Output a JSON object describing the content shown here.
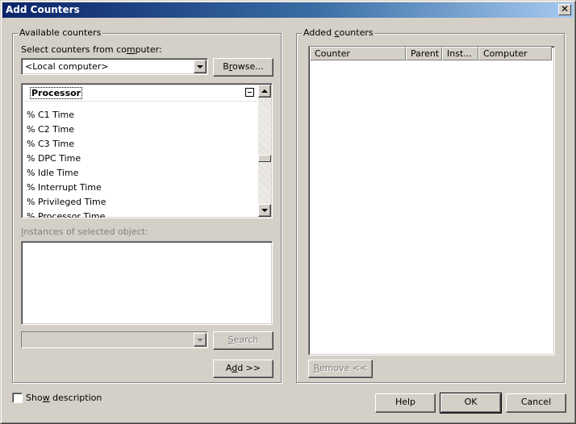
{
  "window": {
    "title": "Add Counters",
    "close_glyph": "✕"
  },
  "available": {
    "legend": "Available counters",
    "select_label_pre": "Select counters from co",
    "select_label_key": "m",
    "select_label_post": "puter:",
    "computer_value": "<Local computer>",
    "browse_label_pre": "B",
    "browse_label_key": "r",
    "browse_label_post": "owse...",
    "object_header": "Processor",
    "counters": [
      "% C1 Time",
      "% C2 Time",
      "% C3 Time",
      "% DPC Time",
      "% Idle Time",
      "% Interrupt Time",
      "% Privileged Time",
      "% Processor Time"
    ],
    "instances_label_key": "I",
    "instances_label_post": "nstances of selected object:",
    "search_label_pre": "",
    "search_label_key": "S",
    "search_label_post": "earch",
    "add_label_pre": "A",
    "add_label_key": "d",
    "add_label_post": "d >>"
  },
  "added": {
    "legend_pre": "Added ",
    "legend_key": "c",
    "legend_post": "ounters",
    "columns": [
      "Counter",
      "Parent",
      "Inst...",
      "Computer"
    ],
    "remove_label_pre": "",
    "remove_label_key": "R",
    "remove_label_post": "emove <<"
  },
  "footer": {
    "show_description_pre": "Sho",
    "show_description_key": "w",
    "show_description_post": " description",
    "show_description_checked": false,
    "help_label": "Help",
    "ok_label": "OK",
    "cancel_label": "Cancel"
  }
}
